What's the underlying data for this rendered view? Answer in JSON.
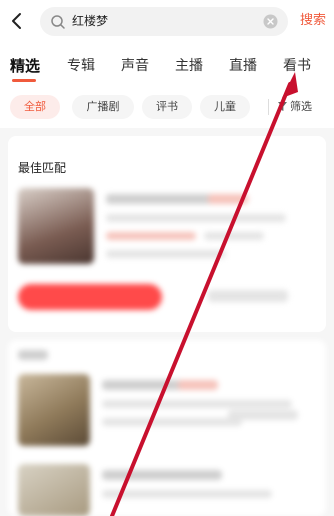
{
  "search": {
    "query": "红楼梦",
    "button_label": "搜索"
  },
  "tabs": [
    {
      "label": "精选",
      "active": true
    },
    {
      "label": "专辑",
      "active": false
    },
    {
      "label": "声音",
      "active": false
    },
    {
      "label": "主播",
      "active": false
    },
    {
      "label": "直播",
      "active": false
    },
    {
      "label": "看书",
      "active": false
    }
  ],
  "filters": {
    "chips": [
      {
        "label": "全部",
        "active": true
      },
      {
        "label": "广播剧",
        "active": false
      },
      {
        "label": "评书",
        "active": false
      },
      {
        "label": "儿童",
        "active": false
      }
    ],
    "filter_label": "筛选"
  },
  "results": {
    "section_title": "最佳匹配"
  },
  "colors": {
    "accent": "#f05a3c",
    "annotation_arrow": "#c8102e"
  },
  "icons": [
    "back-arrow-icon",
    "search-icon",
    "clear-icon",
    "filter-icon"
  ]
}
